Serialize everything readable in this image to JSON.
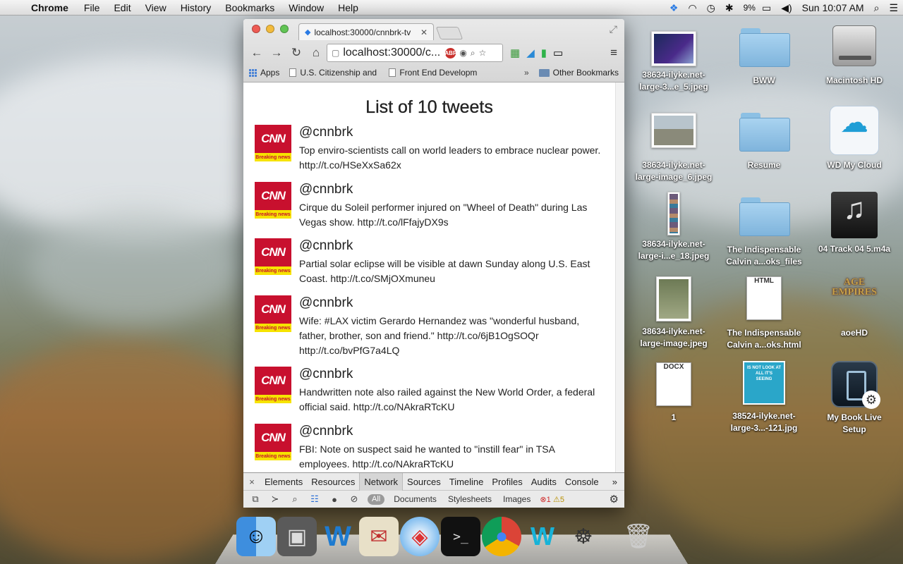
{
  "menubar": {
    "app_name": "Chrome",
    "menus": [
      "File",
      "Edit",
      "View",
      "History",
      "Bookmarks",
      "Window",
      "Help"
    ],
    "battery": "9%",
    "clock": "Sun 10:07 AM"
  },
  "browser": {
    "tab_title": "localhost:30000/cnnbrk-tv",
    "url": "localhost:30000/c...",
    "bookmarks": [
      "Apps",
      "U.S. Citizenship and",
      "Front End Developm",
      "Other Bookmarks"
    ],
    "bookmarks_overflow": "»"
  },
  "page": {
    "title": "List of 10 tweets",
    "avatar_logo": "CNN",
    "avatar_tag": "Breaking news",
    "tweets": [
      {
        "handle": "@cnnbrk",
        "text": "Top enviro-scientists call on world leaders to embrace nuclear power. http://t.co/HSeXxSa62x"
      },
      {
        "handle": "@cnnbrk",
        "text": "Cirque du Soleil performer injured on \"Wheel of Death\" during Las Vegas show. http://t.co/lFfajyDX9s"
      },
      {
        "handle": "@cnnbrk",
        "text": "Partial solar eclipse will be visible at dawn Sunday along U.S. East Coast. http://t.co/SMjOXmuneu"
      },
      {
        "handle": "@cnnbrk",
        "text": "Wife: #LAX victim Gerardo Hernandez was \"wonderful husband, father, brother, son and friend.\" http://t.co/6jB1OgSOQr http://t.co/bvPfG7a4LQ"
      },
      {
        "handle": "@cnnbrk",
        "text": "Handwritten note also railed against the New World Order, a federal official said. http://t.co/NAkraRTcKU"
      },
      {
        "handle": "@cnnbrk",
        "text": "FBI: Note on suspect said he wanted to \"instill fear\" in TSA employees. http://t.co/NAkraRTcKU"
      }
    ]
  },
  "devtools": {
    "close": "×",
    "tabs": [
      "Elements",
      "Resources",
      "Network",
      "Sources",
      "Timeline",
      "Profiles",
      "Audits",
      "Console"
    ],
    "active_tab": "Network",
    "more": "»",
    "filters": [
      "All",
      "Documents",
      "Stylesheets",
      "Images"
    ],
    "errors": "1",
    "warnings": "5"
  },
  "desktop": {
    "icons": [
      {
        "label": "38634-ilyke.net-\nlarge-3...e_5.jpeg"
      },
      {
        "label": "BWW"
      },
      {
        "label": "Macintosh HD"
      },
      {
        "label": "38634-ilyke.net-\nlarge-image_6.jpeg"
      },
      {
        "label": "Resume"
      },
      {
        "label": "WD My Cloud"
      },
      {
        "label": "38634-ilyke.net-\nlarge-i...e_18.jpeg"
      },
      {
        "label": "The Indispensable\nCalvin a...oks_files"
      },
      {
        "label": "04 Track 04 5.m4a"
      },
      {
        "label": "38634-ilyke.net-\nlarge-image.jpeg"
      },
      {
        "label": "The Indispensable\nCalvin a...oks.html"
      },
      {
        "label": "aoeHD"
      },
      {
        "label": "1"
      },
      {
        "label": "38524-ilyke.net-\nlarge-3...-121.jpg"
      },
      {
        "label": "My Book Live\nSetup"
      }
    ],
    "docx_badge": "DOCX",
    "html_badge": "HTML",
    "aoe_text": "AGE\nEMPIRES",
    "poster_text": "IS NOT LOOK AT ALL IT'S SEEING"
  },
  "colors": {
    "cnn_red": "#c8102e",
    "cnn_yellow": "#f6e300",
    "devtools_bg": "#eaeaea"
  }
}
